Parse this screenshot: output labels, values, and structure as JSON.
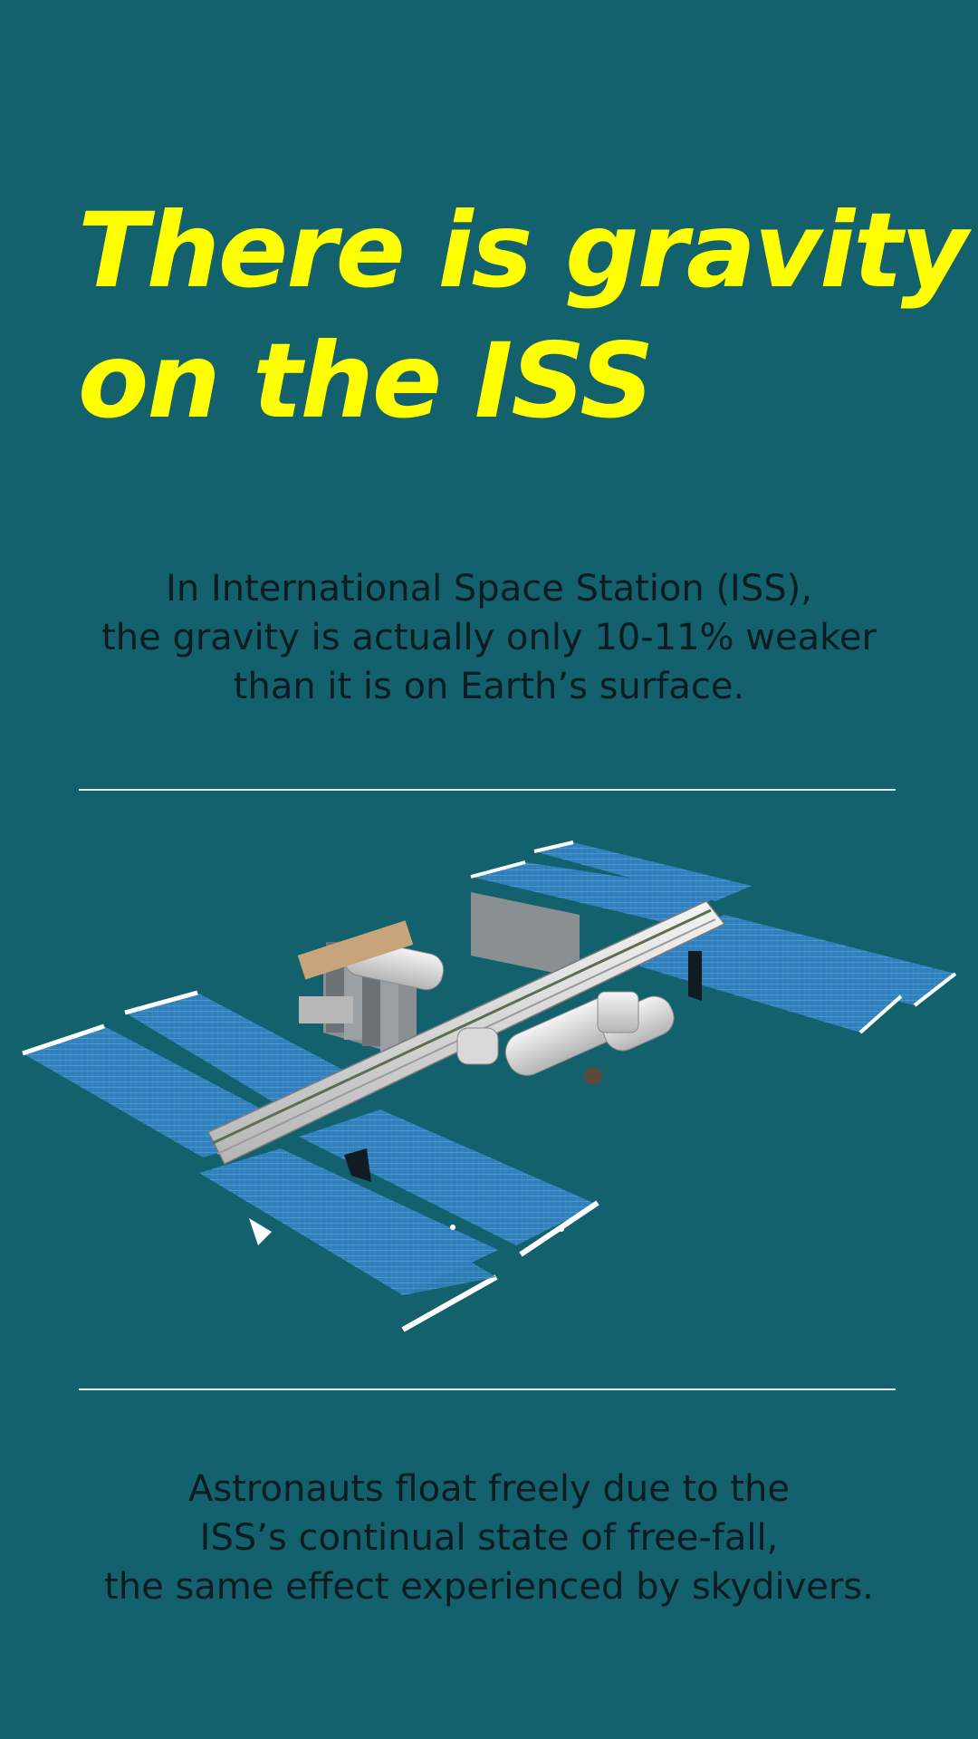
{
  "title": {
    "line1": "There is gravity",
    "line2": "on the ISS"
  },
  "intro": {
    "line1": "In International Space Station (ISS),",
    "line2": "the gravity is actually only 10-11% weaker",
    "line3": "than it is on Earth’s surface."
  },
  "illustration": {
    "icon": "iss-illustration"
  },
  "outro": {
    "line1": "Astronauts float freely due to the",
    "line2": "ISS’s continual state of free-fall,",
    "line3": "the same effect experienced by skydivers."
  },
  "colors": {
    "background": "#12616d",
    "title": "#ffff00",
    "body_text": "#0d1b22",
    "divider": "#e9f2f3",
    "solar_panel": "#2d7fb8"
  }
}
